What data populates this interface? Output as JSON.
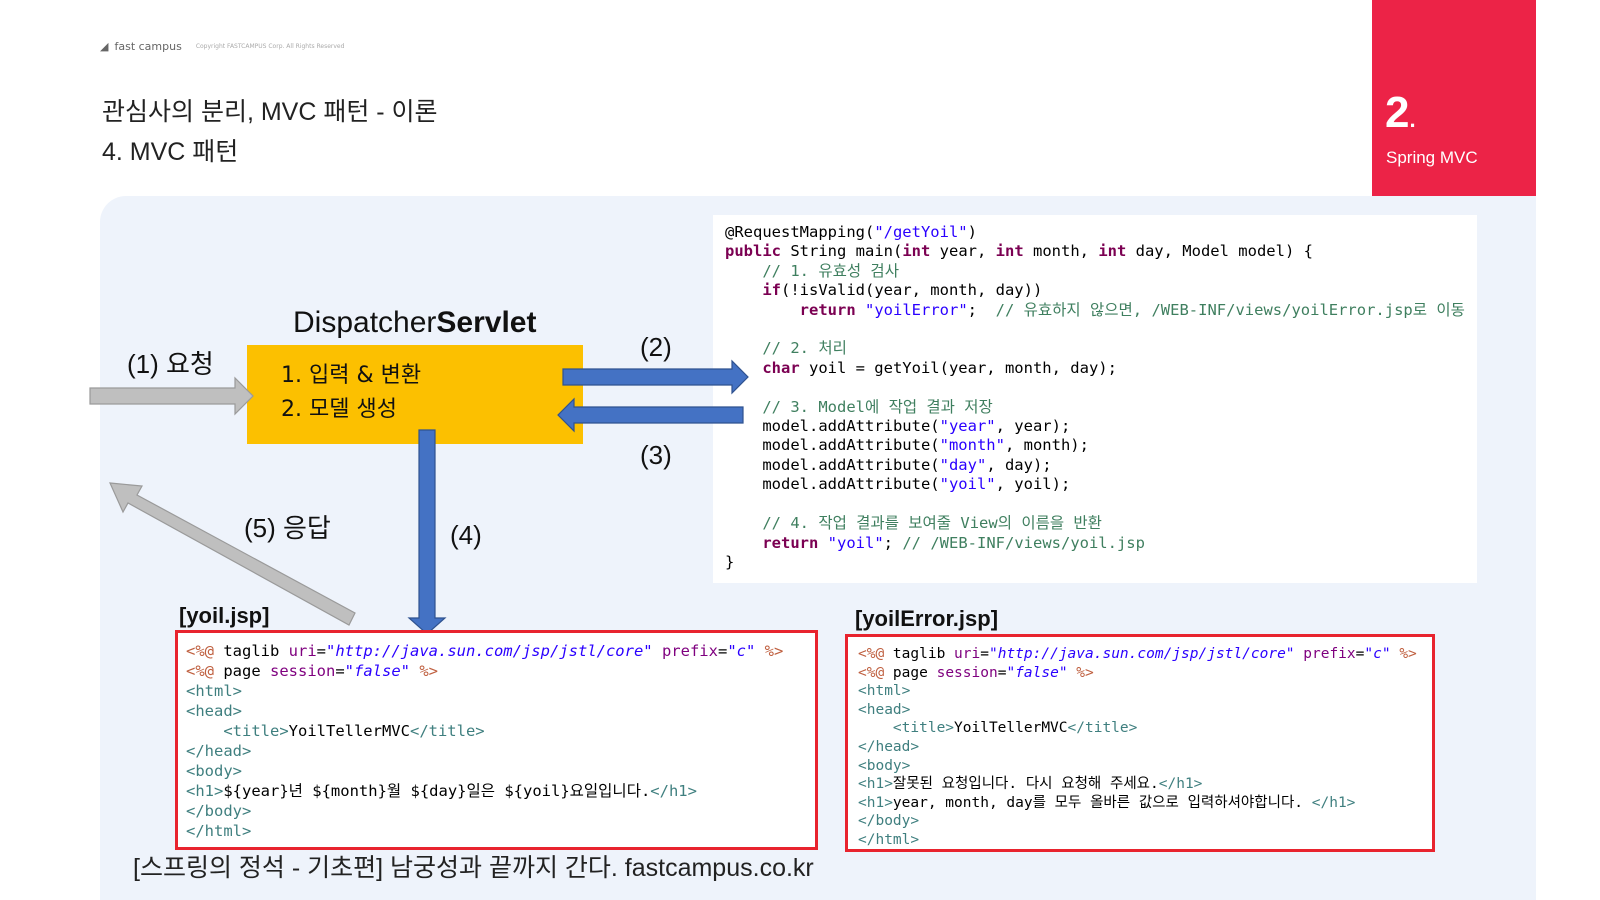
{
  "header": {
    "brand": "fast campus",
    "copyright": "Copyright FASTCAMPUS Corp. All Rights Reserved",
    "title_line1": "관심사의 분리, MVC 패턴 - 이론",
    "title_line2": "4. MVC 패턴"
  },
  "chapter": {
    "number": "2",
    "name": "Spring MVC"
  },
  "dispatcher": {
    "title_normal": "Dispatcher",
    "title_bold": "Servlet",
    "step1": "1. 입력 & 변환",
    "step2": "2. 모델 생성"
  },
  "arrows": {
    "request": "(1) 요청",
    "to_controller": "(2)",
    "from_controller": "(3)",
    "to_view": "(4)",
    "response": "(5) 응답"
  },
  "controller_code": [
    [
      {
        "c": "",
        "t": "@RequestMapping("
      },
      {
        "c": "s",
        "t": "\"/getYoil\""
      },
      {
        "c": "",
        "t": ")"
      }
    ],
    [
      {
        "c": "k",
        "t": "public"
      },
      {
        "c": "",
        "t": " String main("
      },
      {
        "c": "k",
        "t": "int"
      },
      {
        "c": "",
        "t": " year, "
      },
      {
        "c": "k",
        "t": "int"
      },
      {
        "c": "",
        "t": " month, "
      },
      {
        "c": "k",
        "t": "int"
      },
      {
        "c": "",
        "t": " day, Model model) {"
      }
    ],
    [
      {
        "c": "cm",
        "t": "    // 1. 유효성 검사"
      }
    ],
    [
      {
        "c": "",
        "t": "    "
      },
      {
        "c": "k",
        "t": "if"
      },
      {
        "c": "",
        "t": "(!isValid(year, month, day))"
      }
    ],
    [
      {
        "c": "",
        "t": "        "
      },
      {
        "c": "k",
        "t": "return"
      },
      {
        "c": "",
        "t": " "
      },
      {
        "c": "s",
        "t": "\"yoilError\""
      },
      {
        "c": "",
        "t": ";  "
      },
      {
        "c": "cm",
        "t": "// 유효하지 않으면, /WEB-INF/views/yoilError.jsp로 이동"
      }
    ],
    [
      {
        "c": "",
        "t": ""
      }
    ],
    [
      {
        "c": "cm",
        "t": "    // 2. 처리"
      }
    ],
    [
      {
        "c": "",
        "t": "    "
      },
      {
        "c": "k",
        "t": "char"
      },
      {
        "c": "",
        "t": " yoil = getYoil(year, month, day);"
      }
    ],
    [
      {
        "c": "",
        "t": ""
      }
    ],
    [
      {
        "c": "cm",
        "t": "    // 3. Model에 작업 결과 저장"
      }
    ],
    [
      {
        "c": "",
        "t": "    model.addAttribute("
      },
      {
        "c": "s",
        "t": "\"year\""
      },
      {
        "c": "",
        "t": ", year);"
      }
    ],
    [
      {
        "c": "",
        "t": "    model.addAttribute("
      },
      {
        "c": "s",
        "t": "\"month\""
      },
      {
        "c": "",
        "t": ", month);"
      }
    ],
    [
      {
        "c": "",
        "t": "    model.addAttribute("
      },
      {
        "c": "s",
        "t": "\"day\""
      },
      {
        "c": "",
        "t": ", day);"
      }
    ],
    [
      {
        "c": "",
        "t": "    model.addAttribute("
      },
      {
        "c": "s",
        "t": "\"yoil\""
      },
      {
        "c": "",
        "t": ", yoil);"
      }
    ],
    [
      {
        "c": "",
        "t": ""
      }
    ],
    [
      {
        "c": "cm",
        "t": "    // 4. 작업 결과를 보여줄 View의 이름을 반환"
      }
    ],
    [
      {
        "c": "",
        "t": "    "
      },
      {
        "c": "k",
        "t": "return"
      },
      {
        "c": "",
        "t": " "
      },
      {
        "c": "s",
        "t": "\"yoil\""
      },
      {
        "c": "",
        "t": "; "
      },
      {
        "c": "cm",
        "t": "// /WEB-INF/views/yoil.jsp"
      }
    ],
    [
      {
        "c": "",
        "t": "}"
      }
    ]
  ],
  "yoil_jsp": {
    "label": "[yoil.jsp]",
    "lines": [
      [
        {
          "c": "d",
          "t": "<%@"
        },
        {
          "c": "",
          "t": " taglib "
        },
        {
          "c": "a",
          "t": "uri"
        },
        {
          "c": "",
          "t": "="
        },
        {
          "c": "v",
          "t": "\"http://java.sun.com/jsp/jstl/core\""
        },
        {
          "c": "",
          "t": " "
        },
        {
          "c": "a",
          "t": "prefix"
        },
        {
          "c": "",
          "t": "="
        },
        {
          "c": "v",
          "t": "\"c\""
        },
        {
          "c": "",
          "t": " "
        },
        {
          "c": "d",
          "t": "%>"
        }
      ],
      [
        {
          "c": "d",
          "t": "<%@"
        },
        {
          "c": "",
          "t": " page "
        },
        {
          "c": "a",
          "t": "session"
        },
        {
          "c": "",
          "t": "="
        },
        {
          "c": "v",
          "t": "\"false\""
        },
        {
          "c": "",
          "t": " "
        },
        {
          "c": "d",
          "t": "%>"
        }
      ],
      [
        {
          "c": "t",
          "t": "<html>"
        }
      ],
      [
        {
          "c": "t",
          "t": "<head>"
        }
      ],
      [
        {
          "c": "",
          "t": "    "
        },
        {
          "c": "t",
          "t": "<title>"
        },
        {
          "c": "",
          "t": "YoilTellerMVC"
        },
        {
          "c": "t",
          "t": "</title>"
        }
      ],
      [
        {
          "c": "t",
          "t": "</head>"
        }
      ],
      [
        {
          "c": "t",
          "t": "<body>"
        }
      ],
      [
        {
          "c": "t",
          "t": "<h1>"
        },
        {
          "c": "",
          "t": "${year}년 ${month}월 ${day}일은 ${yoil}요일입니다."
        },
        {
          "c": "t",
          "t": "</h1>"
        }
      ],
      [
        {
          "c": "t",
          "t": "</body>"
        }
      ],
      [
        {
          "c": "t",
          "t": "</html>"
        }
      ]
    ]
  },
  "yoil_error_jsp": {
    "label": "[yoilError.jsp]",
    "lines": [
      [
        {
          "c": "d",
          "t": "<%@"
        },
        {
          "c": "",
          "t": " taglib "
        },
        {
          "c": "a",
          "t": "uri"
        },
        {
          "c": "",
          "t": "="
        },
        {
          "c": "v",
          "t": "\"http://java.sun.com/jsp/jstl/core\""
        },
        {
          "c": "",
          "t": " "
        },
        {
          "c": "a",
          "t": "prefix"
        },
        {
          "c": "",
          "t": "="
        },
        {
          "c": "v",
          "t": "\"c\""
        },
        {
          "c": "",
          "t": " "
        },
        {
          "c": "d",
          "t": "%>"
        }
      ],
      [
        {
          "c": "d",
          "t": "<%@"
        },
        {
          "c": "",
          "t": " page "
        },
        {
          "c": "a",
          "t": "session"
        },
        {
          "c": "",
          "t": "="
        },
        {
          "c": "v",
          "t": "\"false\""
        },
        {
          "c": "",
          "t": " "
        },
        {
          "c": "d",
          "t": "%>"
        }
      ],
      [
        {
          "c": "t",
          "t": "<html>"
        }
      ],
      [
        {
          "c": "t",
          "t": "<head>"
        }
      ],
      [
        {
          "c": "",
          "t": "    "
        },
        {
          "c": "t",
          "t": "<title>"
        },
        {
          "c": "",
          "t": "YoilTellerMVC"
        },
        {
          "c": "t",
          "t": "</title>"
        }
      ],
      [
        {
          "c": "t",
          "t": "</head>"
        }
      ],
      [
        {
          "c": "t",
          "t": "<body>"
        }
      ],
      [
        {
          "c": "t",
          "t": "<h1>"
        },
        {
          "c": "",
          "t": "잘못된 요청입니다. 다시 요청해 주세요."
        },
        {
          "c": "t",
          "t": "</h1>"
        }
      ],
      [
        {
          "c": "t",
          "t": "<h1>"
        },
        {
          "c": "",
          "t": "year, month, day를 모두 올바른 값으로 입력하셔야합니다. "
        },
        {
          "c": "t",
          "t": "</h1>"
        }
      ],
      [
        {
          "c": "t",
          "t": "</body>"
        }
      ],
      [
        {
          "c": "t",
          "t": "</html>"
        }
      ]
    ]
  },
  "footer": "[스프링의 정석 - 기초편] 남궁성과 끝까지 간다.  fastcampus.co.kr",
  "colors": {
    "accent_red": "#ec2347",
    "servlet_box": "#fcc000",
    "blue_arrow": "#4472c4",
    "gray_arrow": "#bfbfbf",
    "jsp_border": "#e8232e"
  }
}
